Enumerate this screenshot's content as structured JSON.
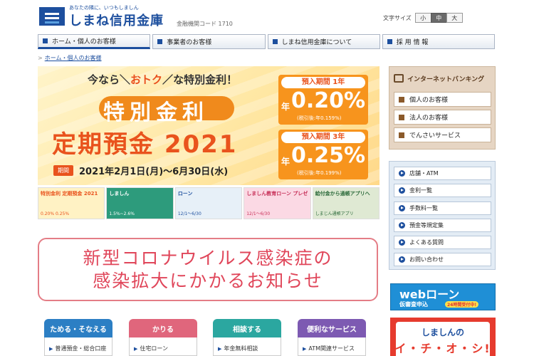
{
  "header": {
    "tagline": "あなたの隣に、いつもしましん",
    "bank_name": "しまね信用金庫",
    "institution_code": "金融機関コード 1710",
    "font_size_label": "文字サイズ",
    "font_sizes": [
      "小",
      "中",
      "大"
    ],
    "font_size_selected": "中"
  },
  "nav": {
    "items": [
      "ホーム・個人のお客様",
      "事業者のお客様",
      "しまね信用金庫について",
      "採 用 情 報"
    ]
  },
  "breadcrumb": {
    "current": "ホーム・個人のお客様"
  },
  "hero": {
    "catch_pre": "今なら",
    "catch_accent": "おトク",
    "catch_post": "な特別金利！",
    "title1": "特別金利",
    "title2": "定期預金 2021",
    "period_label": "期間",
    "period_text": "2021年2月1日(月)～6月30日(水)",
    "rates": [
      {
        "term": "預入期間 1年",
        "prefix": "年",
        "rate": "0.20%",
        "tax": "(税引後:年0.159%)"
      },
      {
        "term": "預入期間 3年",
        "prefix": "年",
        "rate": "0.25%",
        "tax": "(税引後:年0.199%)"
      }
    ]
  },
  "thumbs": [
    {
      "label": "特別金利 定期預金 2021",
      "sub": "0.20% 0.25%"
    },
    {
      "label": "しましん",
      "sub": "1.5%~2.6%"
    },
    {
      "label": "ローン",
      "sub": "12/1～6/30"
    },
    {
      "label": "しましん教育ローン プレゼントキャンペーン",
      "sub": "12/1～6/30"
    },
    {
      "label": "給付金から通帳アプリへ",
      "sub": "しまじん通帳アプリ"
    }
  ],
  "notice": {
    "line1": "新型コロナウイルス感染症の",
    "line2": "感染拡大にかかるお知らせ"
  },
  "categories": [
    {
      "label": "ためる・そなえる",
      "link": "普通預金・総合口座",
      "color": "#2c7fc4"
    },
    {
      "label": "かりる",
      "link": "住宅ローン",
      "color": "#e0667c"
    },
    {
      "label": "相談する",
      "link": "年金無料相談",
      "color": "#2ba7a0"
    },
    {
      "label": "便利なサービス",
      "link": "ATM関連サービス",
      "color": "#7d5ab2"
    }
  ],
  "sidebar": {
    "ib_title": "インターネットバンキング",
    "ib_items": [
      "個人のお客様",
      "法人のお客様",
      "でんさいサービス"
    ],
    "links": [
      "店舗・ATM",
      "金利一覧",
      "手数料一覧",
      "預金等規定集",
      "よくある質問",
      "お問い合わせ"
    ],
    "web_loan_title": "webローン",
    "web_loan_sub": "仮審査申込",
    "web_loan_badge": "24時間受付中!",
    "ichi_line1": "しましんの",
    "ichi_line2": "イ・チ・オ・シ!"
  }
}
